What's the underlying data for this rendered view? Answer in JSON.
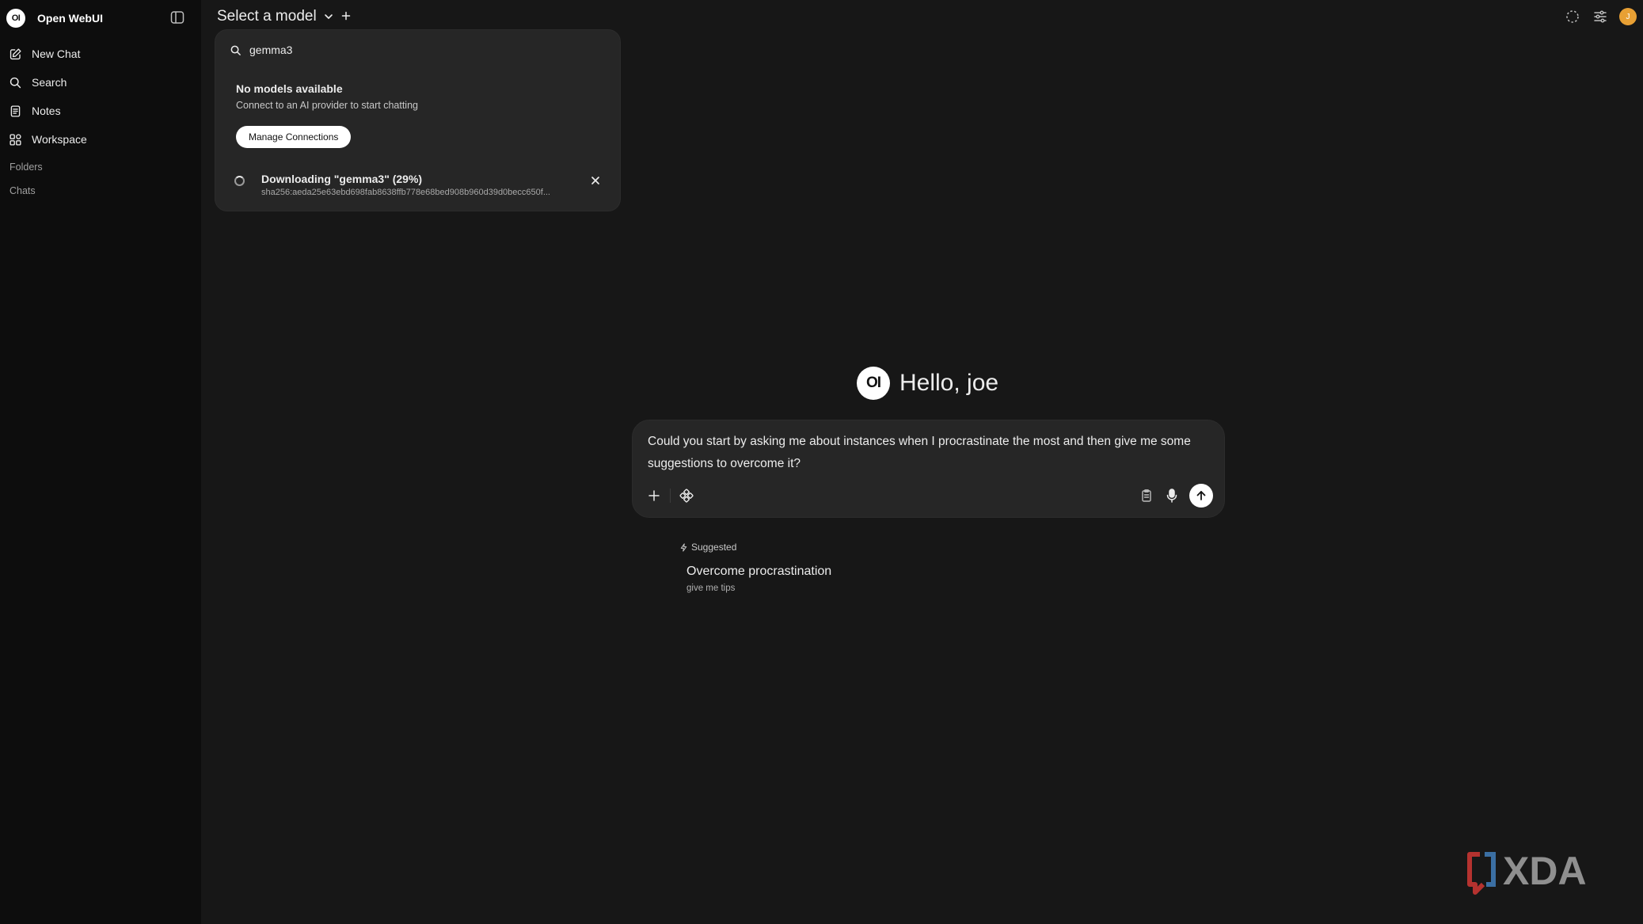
{
  "app": {
    "brand_logo": "OI",
    "brand_name": "Open WebUI"
  },
  "sidebar": {
    "items": [
      {
        "label": "New Chat",
        "icon": "pencil-square-icon"
      },
      {
        "label": "Search",
        "icon": "search-icon"
      },
      {
        "label": "Notes",
        "icon": "notes-icon"
      },
      {
        "label": "Workspace",
        "icon": "grid-icon"
      }
    ],
    "folders_label": "Folders",
    "chats_label": "Chats"
  },
  "header": {
    "model_selector_label": "Select a model",
    "avatar_initial": "J",
    "avatar_color": "#e8a034"
  },
  "model_dropdown": {
    "search_value": "gemma3",
    "empty_title": "No models available",
    "empty_subtitle": "Connect to an AI provider to start chatting",
    "manage_button": "Manage Connections",
    "download": {
      "title": "Downloading \"gemma3\" (29%)",
      "hash": "sha256:aeda25e63ebd698fab8638ffb778e68bed908b960d39d0becc650f..."
    }
  },
  "greeting": {
    "logo": "OI",
    "text": "Hello, joe"
  },
  "chat_input": {
    "value": "Could you start by asking me about instances when I procrastinate the most and then give me some suggestions to overcome it?"
  },
  "suggestions": {
    "label": "Suggested",
    "items": [
      {
        "title": "Overcome procrastination",
        "subtitle": "give me tips"
      }
    ]
  },
  "watermark": {
    "text": "XDA"
  }
}
